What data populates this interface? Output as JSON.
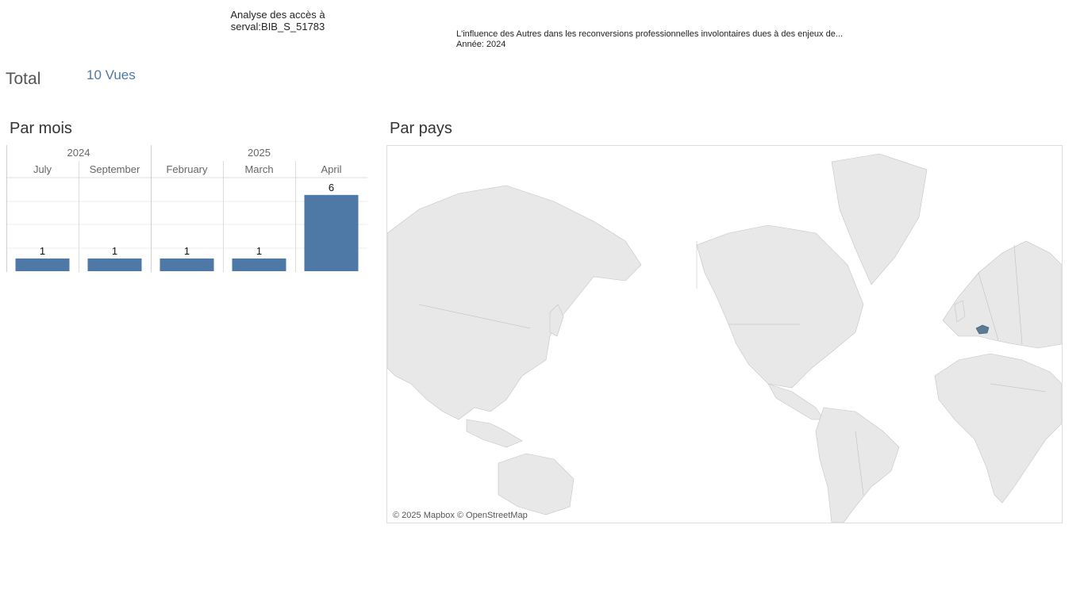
{
  "header": {
    "title_line1": "Analyse des accès à",
    "title_line2": "serval:BIB_S_51783",
    "doc_title": "L'influence des Autres dans les reconversions professionnelles involontaires dues à des enjeux de...",
    "doc_year": "Année: 2024"
  },
  "summary": {
    "total_label": "Total",
    "total_views": "10 Vues"
  },
  "sections": {
    "by_month": "Par mois",
    "by_country": "Par pays"
  },
  "map": {
    "attribution": "© 2025 Mapbox © OpenStreetMap",
    "highlighted_country": "Switzerland",
    "highlight_color": "#5a7a96",
    "land_color": "#e8e8e8",
    "border_color": "#b8b8b8"
  },
  "chart_data": {
    "type": "bar",
    "year_groups": [
      {
        "year": "2024",
        "months": [
          "July",
          "September"
        ]
      },
      {
        "year": "2025",
        "months": [
          "February",
          "March",
          "April"
        ]
      }
    ],
    "categories": [
      "July",
      "September",
      "February",
      "March",
      "April"
    ],
    "values": [
      1,
      1,
      1,
      1,
      6
    ],
    "ylim": [
      0,
      6
    ],
    "bar_color": "#4e79a7",
    "grid": true
  }
}
